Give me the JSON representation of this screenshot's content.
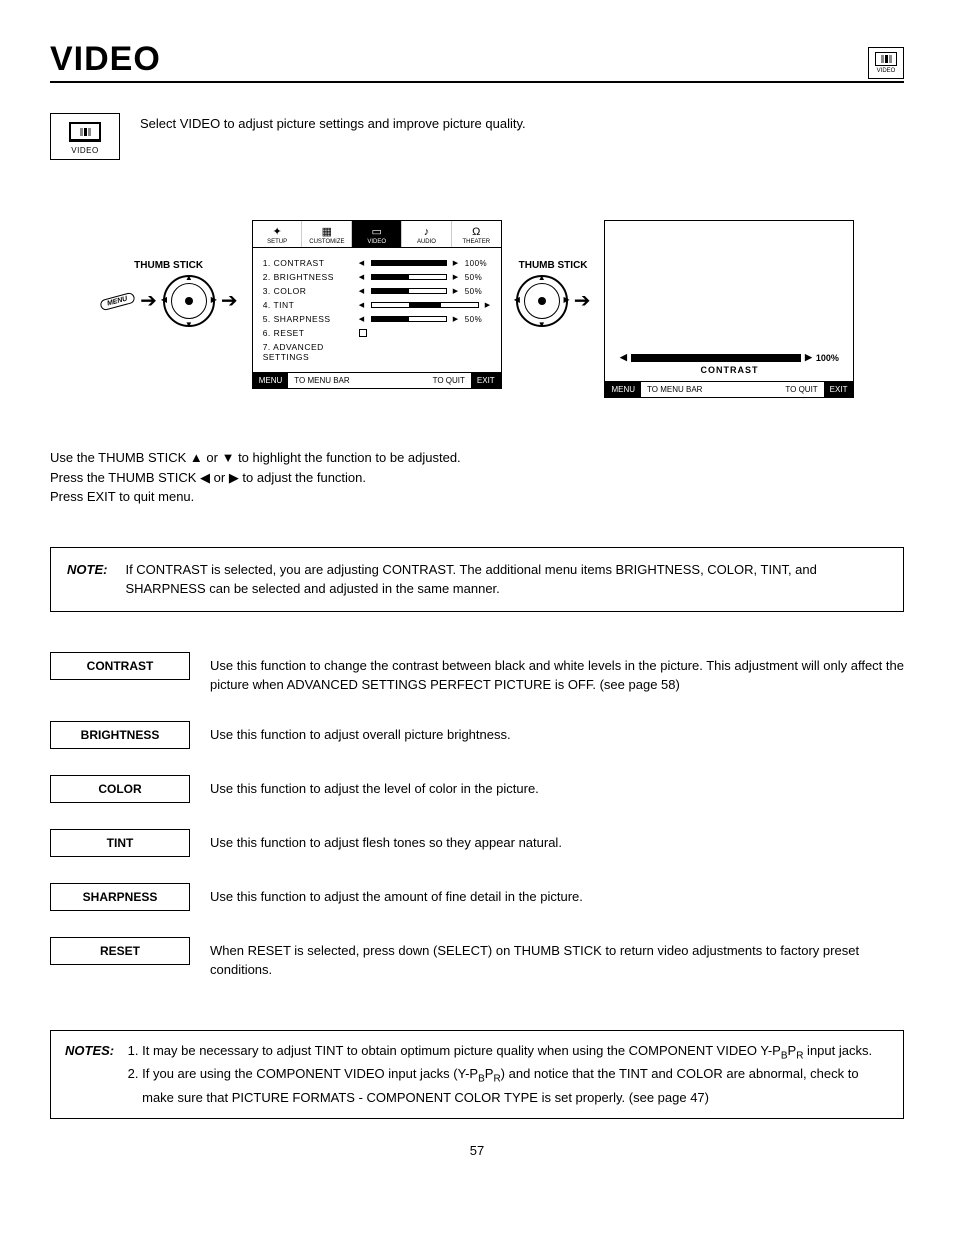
{
  "page": {
    "title": "VIDEO",
    "number": "57"
  },
  "header_icon": {
    "label": "VIDEO"
  },
  "intro": {
    "icon_label": "VIDEO",
    "text": "Select VIDEO to adjust picture settings and improve picture quality."
  },
  "diagram": {
    "thumb_label": "THUMB STICK",
    "menu_badge": "MENU",
    "osd_tabs": [
      "SETUP",
      "CUSTOMIZE",
      "VIDEO",
      "AUDIO",
      "THEATER"
    ],
    "osd_active_tab": 2,
    "osd_items": [
      {
        "n": "1.",
        "label": "CONTRAST",
        "pct": "100%",
        "fill": 100
      },
      {
        "n": "2.",
        "label": "BRIGHTNESS",
        "pct": "50%",
        "fill": 50
      },
      {
        "n": "3.",
        "label": "COLOR",
        "pct": "50%",
        "fill": 50
      },
      {
        "n": "4.",
        "label": "TINT",
        "pct": "",
        "tint": true
      },
      {
        "n": "5.",
        "label": "SHARPNESS",
        "pct": "50%",
        "fill": 50
      },
      {
        "n": "6.",
        "label": "RESET",
        "checkbox": true
      },
      {
        "n": "7.",
        "label": "ADVANCED SETTINGS"
      }
    ],
    "osd_footer": {
      "a": "MENU",
      "b": "TO MENU BAR",
      "c": "TO QUIT",
      "d": "EXIT"
    },
    "contrast_value": "100%",
    "contrast_caption": "CONTRAST"
  },
  "instructions": {
    "line1a": "Use the THUMB STICK ",
    "line1b": " or ",
    "line1c": " to highlight the function to be adjusted.",
    "line2a": "Press the THUMB STICK ",
    "line2b": " or ",
    "line2c": " to adjust the function.",
    "line3": "Press EXIT to quit menu."
  },
  "note": {
    "label": "NOTE:",
    "text": "If CONTRAST is selected, you are adjusting CONTRAST.  The additional menu items BRIGHTNESS, COLOR, TINT, and SHARPNESS can be selected and adjusted in the same manner."
  },
  "functions": [
    {
      "label": "CONTRAST",
      "desc": "Use this function to change the contrast between black and white levels in the picture.  This adjustment will only affect the picture when ADVANCED SETTINGS PERFECT PICTURE is OFF. (see page 58)"
    },
    {
      "label": "BRIGHTNESS",
      "desc": "Use this function to adjust overall picture brightness."
    },
    {
      "label": "COLOR",
      "desc": "Use this function to adjust the level of color in the picture."
    },
    {
      "label": "TINT",
      "desc": "Use this function to adjust flesh tones so they appear natural."
    },
    {
      "label": "SHARPNESS",
      "desc": "Use this function to adjust the amount of fine detail in the picture."
    },
    {
      "label": "RESET",
      "desc": "When RESET is selected, press down (SELECT) on THUMB STICK to return video adjustments to factory preset conditions."
    }
  ],
  "notes": {
    "label": "NOTES:",
    "item1a": "It may be necessary to adjust TINT to obtain optimum picture quality when using the COMPONENT VIDEO Y-P",
    "item1b": "P",
    "item1c": " input jacks.",
    "item2a": "If you are using the COMPONENT VIDEO input jacks (Y-P",
    "item2b": "P",
    "item2c": ") and notice that the TINT and COLOR are abnormal, check to make sure that PICTURE FORMATS - COMPONENT COLOR TYPE is set properly. (see page 47)"
  }
}
